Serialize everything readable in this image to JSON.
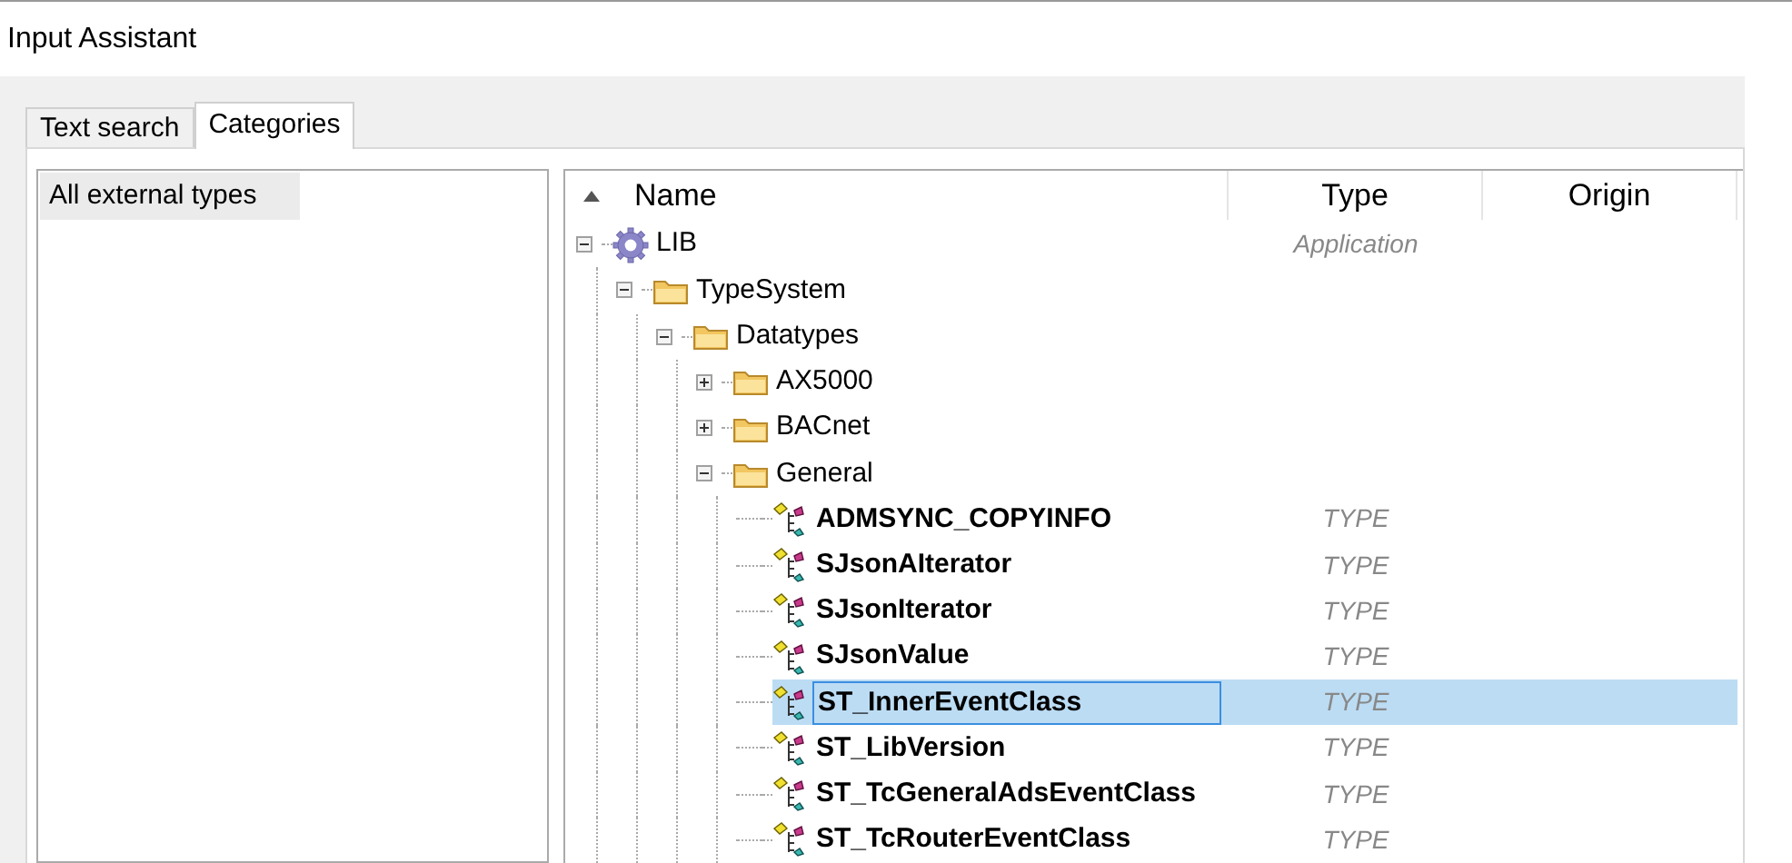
{
  "window": {
    "title": "Input Assistant"
  },
  "tabs": [
    {
      "label": "Text search",
      "selected": false
    },
    {
      "label": "Categories",
      "selected": true
    }
  ],
  "categories": [
    {
      "label": "All external types",
      "selected": true
    }
  ],
  "tree": {
    "columns": [
      {
        "label": "Name",
        "sorted": true
      },
      {
        "label": "Type",
        "sorted": false
      },
      {
        "label": "Origin",
        "sorted": false
      }
    ],
    "nodes": [
      {
        "name": "LIB",
        "kind": "library",
        "type": "Application",
        "expanded": true,
        "selected": false,
        "children": [
          {
            "name": "TypeSystem",
            "kind": "folder",
            "expanded": true,
            "selected": false,
            "children": [
              {
                "name": "Datatypes",
                "kind": "folder",
                "expanded": true,
                "selected": false,
                "children": [
                  {
                    "name": "AX5000",
                    "kind": "folder",
                    "expanded": false,
                    "selected": false
                  },
                  {
                    "name": "BACnet",
                    "kind": "folder",
                    "expanded": false,
                    "selected": false
                  },
                  {
                    "name": "General",
                    "kind": "folder",
                    "expanded": true,
                    "selected": false,
                    "children": [
                      {
                        "name": "ADMSYNC_COPYINFO",
                        "kind": "type",
                        "type": "TYPE",
                        "selected": false
                      },
                      {
                        "name": "SJsonAIterator",
                        "kind": "type",
                        "type": "TYPE",
                        "selected": false
                      },
                      {
                        "name": "SJsonIterator",
                        "kind": "type",
                        "type": "TYPE",
                        "selected": false
                      },
                      {
                        "name": "SJsonValue",
                        "kind": "type",
                        "type": "TYPE",
                        "selected": false
                      },
                      {
                        "name": "ST_InnerEventClass",
                        "kind": "type",
                        "type": "TYPE",
                        "selected": true
                      },
                      {
                        "name": "ST_LibVersion",
                        "kind": "type",
                        "type": "TYPE",
                        "selected": false
                      },
                      {
                        "name": "ST_TcGeneralAdsEventClass",
                        "kind": "type",
                        "type": "TYPE",
                        "selected": false
                      },
                      {
                        "name": "ST_TcRouterEventClass",
                        "kind": "type",
                        "type": "TYPE",
                        "selected": false
                      }
                    ]
                  }
                ]
              }
            ]
          }
        ]
      }
    ]
  }
}
